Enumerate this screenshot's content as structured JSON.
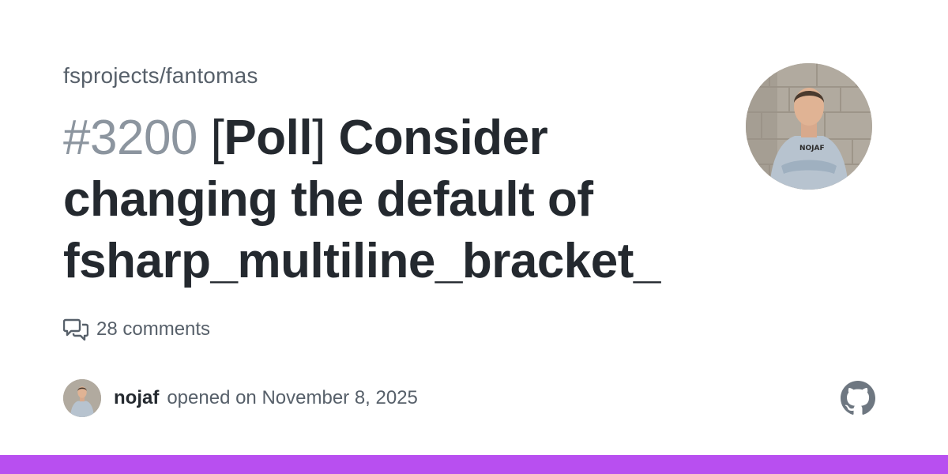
{
  "repo": "fsprojects/fantomas",
  "issue": {
    "number": "#3200",
    "title_bracket_open": "[",
    "title_bracket_word": "Poll",
    "title_bracket_close": "]",
    "title_line1_rest": " Consider",
    "title_line2": "changing the default of",
    "title_line3": "fsharp_multiline_bracket_"
  },
  "comments": {
    "label": "28 comments"
  },
  "author": {
    "name": "nojaf",
    "action": "opened on November 8, 2025"
  },
  "colors": {
    "bottom_bar": "#b84ff0",
    "muted": "#57606a",
    "title": "#24292f",
    "number": "#8c959f"
  }
}
